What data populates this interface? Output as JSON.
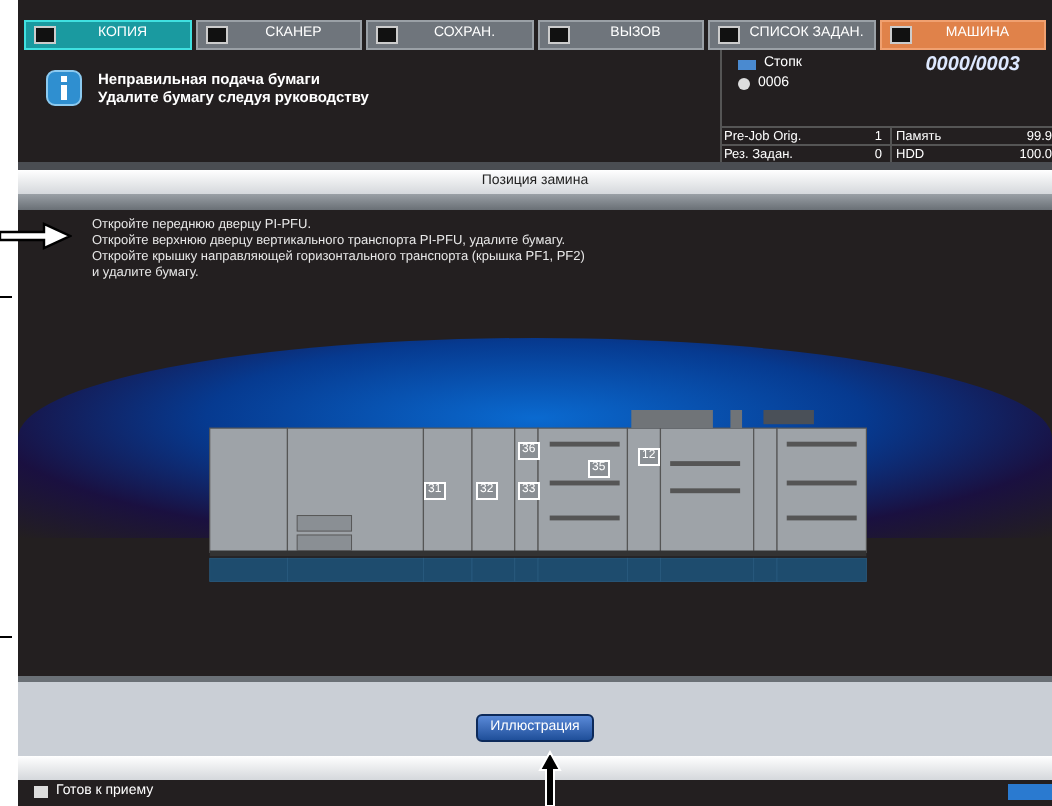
{
  "tabs": [
    {
      "label": "КОПИЯ",
      "selected": true,
      "alert": false
    },
    {
      "label": "СКАНЕР",
      "selected": false,
      "alert": false
    },
    {
      "label": "СОХРАН.",
      "selected": false,
      "alert": false
    },
    {
      "label": "ВЫЗОВ",
      "selected": false,
      "alert": false
    },
    {
      "label": "СПИСОК ЗАДАН.",
      "selected": false,
      "alert": false
    },
    {
      "label": "МАШИНА",
      "selected": false,
      "alert": true
    }
  ],
  "message": {
    "lines": [
      "Неправильная подача бумаги",
      "Удалите бумагу следуя руководству"
    ]
  },
  "status_panel": {
    "stack_label": "Стопк",
    "counter": "0000/0003",
    "user_count": "0006",
    "rows": [
      {
        "label": "Pre-Job Orig.",
        "value": "1",
        "label_2": "Память",
        "value_2": "99.9"
      },
      {
        "label": "Рез. Задан.",
        "value": "0",
        "label_2": "HDD",
        "value_2": "100.0"
      }
    ]
  },
  "section_title": "Позиция замина",
  "instructions": [
    "Откройте переднюю дверцу PI-PFU.",
    "Откройте верхнюю дверцу вертикального транспорта PI-PFU, удалите бумагу.",
    "Откройте крышку направляющей горизонтального транспорта (крышка PF1, PF2)",
    "и удалите бумагу."
  ],
  "jam_markers": [
    "31",
    "32",
    "33",
    "36",
    "35",
    "12"
  ],
  "illustration_button": "Иллюстрация",
  "status_bar": {
    "text": "Готов к приему"
  }
}
